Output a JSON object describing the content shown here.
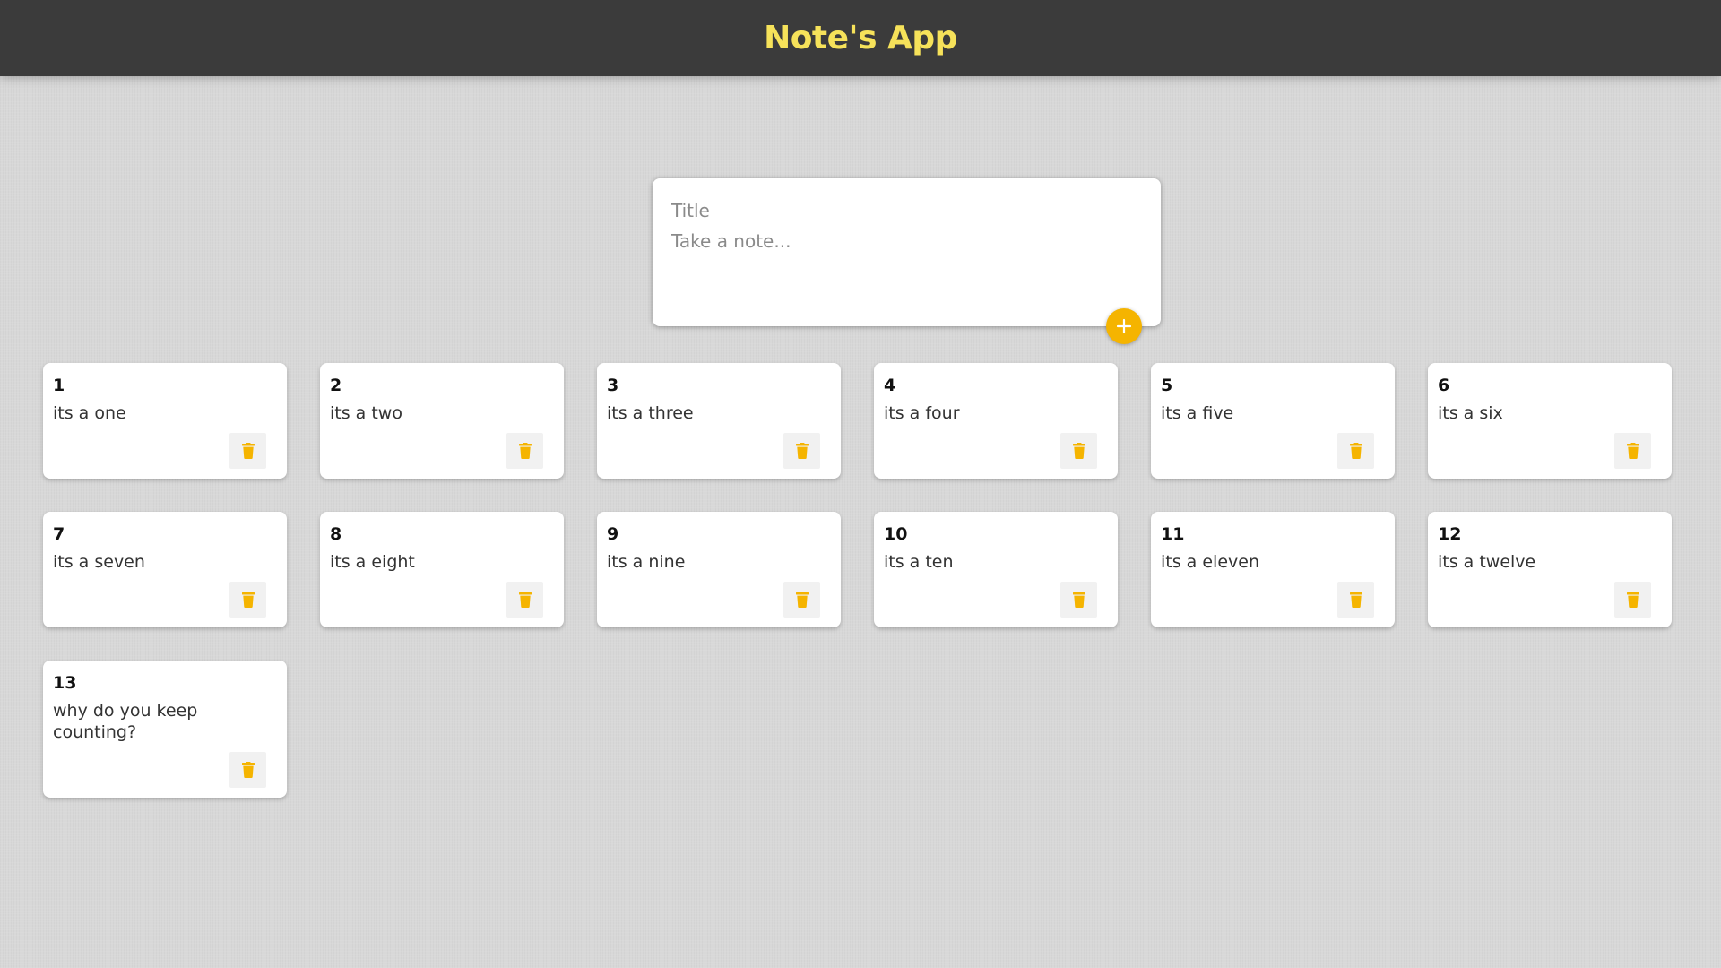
{
  "header": {
    "title": "Note's App"
  },
  "create_note": {
    "title_placeholder": "Title",
    "content_placeholder": "Take a note...",
    "add_icon": "plus-icon"
  },
  "colors": {
    "header_bg": "#3b3b3b",
    "header_title": "#f6e25a",
    "accent": "#f5b400",
    "background": "#d8d8d8",
    "card": "#ffffff"
  },
  "notes": [
    {
      "title": "1",
      "content": "its a one",
      "icon": "trash-icon"
    },
    {
      "title": "2",
      "content": "its a two",
      "icon": "trash-icon"
    },
    {
      "title": "3",
      "content": "its a three",
      "icon": "trash-icon"
    },
    {
      "title": "4",
      "content": "its a four",
      "icon": "trash-icon"
    },
    {
      "title": "5",
      "content": "its a five",
      "icon": "trash-icon"
    },
    {
      "title": "6",
      "content": "its a six",
      "icon": "trash-icon"
    },
    {
      "title": "7",
      "content": "its a seven",
      "icon": "trash-icon"
    },
    {
      "title": "8",
      "content": "its a eight",
      "icon": "trash-icon"
    },
    {
      "title": "9",
      "content": "its a nine",
      "icon": "trash-icon"
    },
    {
      "title": "10",
      "content": "its a ten",
      "icon": "trash-icon"
    },
    {
      "title": "11",
      "content": "its a eleven",
      "icon": "trash-icon"
    },
    {
      "title": "12",
      "content": "its a twelve",
      "icon": "trash-icon"
    },
    {
      "title": "13",
      "content": "why do you keep counting?",
      "icon": "trash-icon"
    }
  ]
}
